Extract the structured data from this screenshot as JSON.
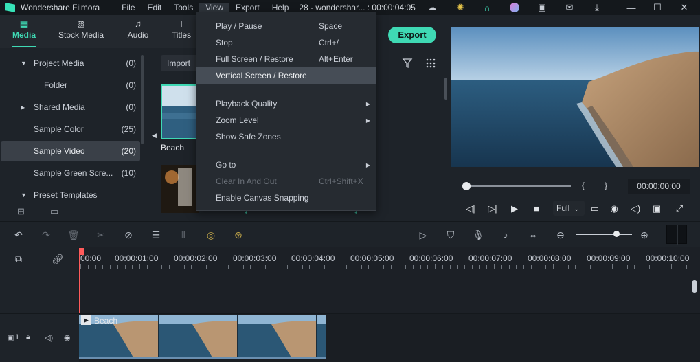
{
  "titlebar": {
    "app_name": "Wondershare Filmora",
    "menus": [
      "File",
      "Edit",
      "Tools",
      "View",
      "Export",
      "Help"
    ],
    "doc_title": "28 - wondershar... : 00:00:04:05"
  },
  "tabs": [
    {
      "label": "Media",
      "icon": "media-icon"
    },
    {
      "label": "Stock Media",
      "icon": "stock-media-icon"
    },
    {
      "label": "Audio",
      "icon": "audio-icon"
    },
    {
      "label": "Titles",
      "icon": "titles-icon"
    }
  ],
  "sidebar": {
    "items": [
      {
        "label": "Project Media",
        "count": "(0)"
      },
      {
        "label": "Folder",
        "count": "(0)"
      },
      {
        "label": "Shared Media",
        "count": "(0)"
      },
      {
        "label": "Sample Color",
        "count": "(25)"
      },
      {
        "label": "Sample Video",
        "count": "(20)"
      },
      {
        "label": "Sample Green Scre...",
        "count": "(10)"
      },
      {
        "label": "Preset Templates",
        "count": ""
      }
    ]
  },
  "media": {
    "import_label": "Import",
    "thumb_label": "Beach",
    "export_label": "Export"
  },
  "view_menu": {
    "items": [
      {
        "label": "Play / Pause",
        "shortcut": "Space"
      },
      {
        "label": "Stop",
        "shortcut": "Ctrl+/"
      },
      {
        "label": "Full Screen / Restore",
        "shortcut": "Alt+Enter"
      },
      {
        "label": "Vertical Screen / Restore",
        "shortcut": ""
      },
      {
        "label": "Playback Quality",
        "shortcut": ""
      },
      {
        "label": "Zoom Level",
        "shortcut": ""
      },
      {
        "label": "Show Safe Zones",
        "shortcut": ""
      },
      {
        "label": "Go to",
        "shortcut": ""
      },
      {
        "label": "Clear In And Out",
        "shortcut": "Ctrl+Shift+X"
      },
      {
        "label": "Enable Canvas Snapping",
        "shortcut": ""
      }
    ]
  },
  "preview": {
    "mark_in": "{",
    "mark_out": "}",
    "timecode": "00:00:00:00",
    "quality": "Full"
  },
  "timeline": {
    "ruler": [
      "00:00",
      "00:00:01:00",
      "00:00:02:00",
      "00:00:03:00",
      "00:00:04:00",
      "00:00:05:00",
      "00:00:06:00",
      "00:00:07:00",
      "00:00:08:00",
      "00:00:09:00",
      "00:00:10:00"
    ],
    "clip_label": "Beach",
    "track_number": "1"
  },
  "colors": {
    "accent": "#3fd9b4",
    "playhead": "#ff5b5b",
    "background": "#1e2329"
  }
}
